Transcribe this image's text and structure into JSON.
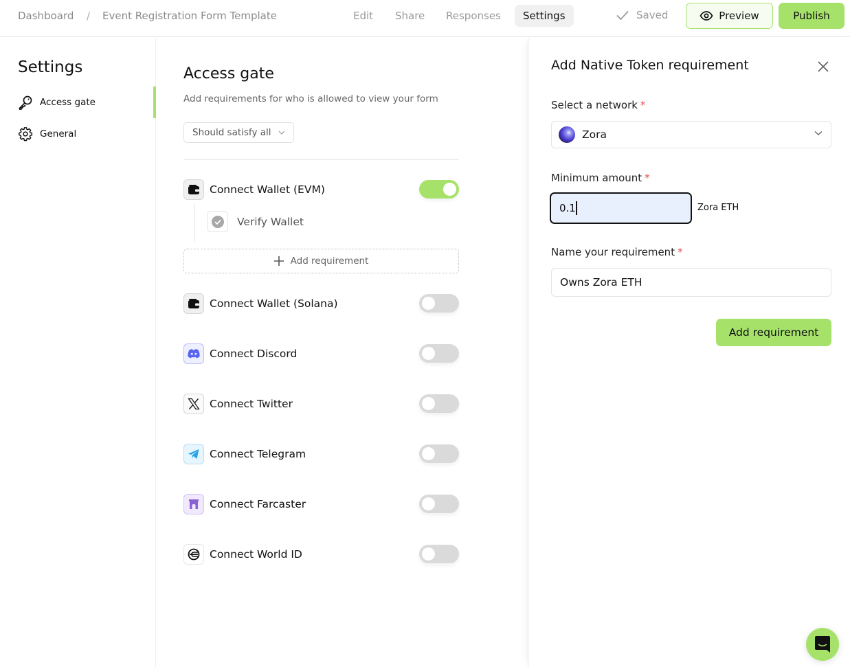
{
  "header": {
    "breadcrumb": {
      "dashboard": "Dashboard",
      "separator": "/",
      "form_name": "Event Registration Form Template"
    },
    "tabs": [
      {
        "label": "Edit",
        "active": false
      },
      {
        "label": "Share",
        "active": false
      },
      {
        "label": "Responses",
        "active": false
      },
      {
        "label": "Settings",
        "active": true
      }
    ],
    "status": "Saved",
    "preview_label": "Preview",
    "publish_label": "Publish"
  },
  "sidebar": {
    "title": "Settings",
    "items": [
      {
        "label": "Access gate",
        "icon": "key-icon",
        "active": true
      },
      {
        "label": "General",
        "icon": "gear-icon",
        "active": false
      }
    ]
  },
  "main": {
    "title": "Access gate",
    "subtitle": "Add requirements for who is allowed to view your form",
    "satisfy_select": "Should satisfy all",
    "requirements": [
      {
        "label": "Connect Wallet (EVM)",
        "icon": "wallet-icon",
        "enabled": true
      },
      {
        "label": "Connect Wallet (Solana)",
        "icon": "wallet-icon",
        "enabled": false
      },
      {
        "label": "Connect Discord",
        "icon": "discord-icon",
        "enabled": false
      },
      {
        "label": "Connect Twitter",
        "icon": "x-twitter-icon",
        "enabled": false
      },
      {
        "label": "Connect Telegram",
        "icon": "telegram-icon",
        "enabled": false
      },
      {
        "label": "Connect Farcaster",
        "icon": "farcaster-icon",
        "enabled": false
      },
      {
        "label": "Connect World ID",
        "icon": "worldid-icon",
        "enabled": false
      }
    ],
    "sub_requirement": "Verify Wallet",
    "add_requirement_label": "Add requirement"
  },
  "panel": {
    "title": "Add Native Token requirement",
    "network_label": "Select a network",
    "network_value": "Zora",
    "amount_label": "Minimum amount",
    "amount_value": "0.1",
    "amount_unit": "Zora ETH",
    "name_label": "Name your requirement",
    "name_value": "Owns Zora ETH",
    "required_mark": "*",
    "submit_label": "Add requirement"
  },
  "colors": {
    "accent": "#a6e26a",
    "required": "#e5484d",
    "input_focus_bg": "#e8f0fe"
  }
}
